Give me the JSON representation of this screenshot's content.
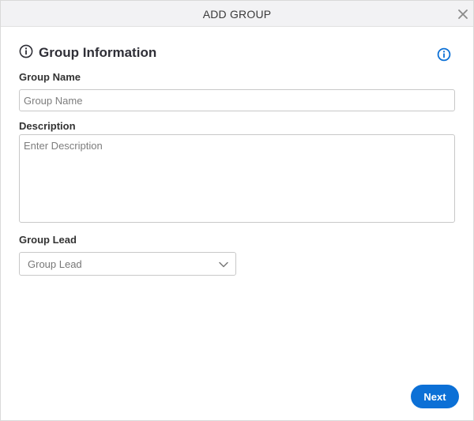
{
  "dialog": {
    "title": "ADD GROUP",
    "close_icon": "close-icon"
  },
  "section": {
    "title": "Group Information",
    "title_icon": "info-outline-icon",
    "help_icon": "info-circle-icon"
  },
  "fields": {
    "group_name": {
      "label": "Group Name",
      "placeholder": "Group Name",
      "value": ""
    },
    "description": {
      "label": "Description",
      "placeholder": "Enter Description",
      "value": ""
    },
    "group_lead": {
      "label": "Group Lead",
      "selected": "Group Lead",
      "icon": "chevron-down-icon"
    }
  },
  "footer": {
    "next_label": "Next"
  },
  "colors": {
    "accent": "#0c70d6",
    "titlebar_bg": "#f2f2f4",
    "border": "#c8c8c8"
  }
}
